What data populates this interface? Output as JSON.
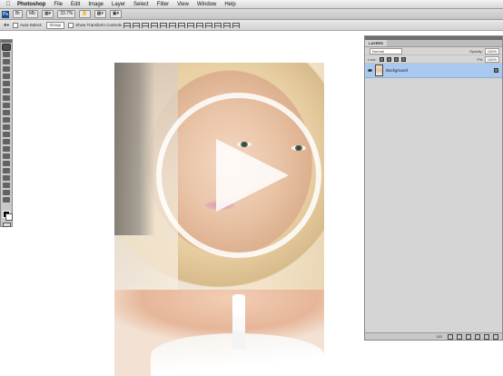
{
  "menubar": {
    "items": [
      "Photoshop",
      "File",
      "Edit",
      "Image",
      "Layer",
      "Select",
      "Filter",
      "View",
      "Window",
      "Help"
    ]
  },
  "appbar": {
    "logo": "Ps",
    "zoom": "33.7%"
  },
  "options": {
    "auto_select_label": "Auto-Select:",
    "auto_select_value": "Group",
    "transform_label": "Show Transform Controls"
  },
  "layers": {
    "tab_label": "LAYERS",
    "blend_mode": "Normal",
    "opacity_label": "Opacity:",
    "opacity_value": "100%",
    "lock_label": "Lock:",
    "fill_label": "Fill:",
    "fill_value": "100%",
    "layer_name": "Background",
    "bottom_label": "GO"
  },
  "colors": {
    "layer_selected": "#a8c8ef",
    "panel_bg": "#d5d5d5",
    "play_overlay": "#ffffff"
  },
  "icons": [
    "apple-icon",
    "move-tool-icon",
    "eye-icon",
    "lock-icon",
    "play-icon"
  ]
}
